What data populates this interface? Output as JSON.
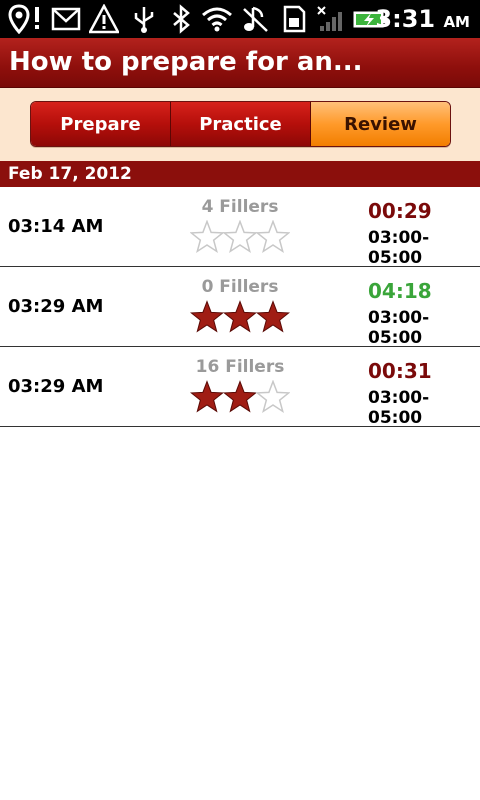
{
  "status_bar": {
    "time": "3:31",
    "ampm": "AM",
    "icons": [
      "location-alert-icon",
      "gmail-icon",
      "warning-icon",
      "usb-icon",
      "bluetooth-icon",
      "wifi-icon",
      "music-off-icon",
      "sd-card-icon",
      "no-signal-icon",
      "battery-charging-icon"
    ]
  },
  "header": {
    "title": "How to prepare for an..."
  },
  "tabs": [
    {
      "label": "Prepare",
      "active": false
    },
    {
      "label": "Practice",
      "active": false
    },
    {
      "label": "Review",
      "active": true
    }
  ],
  "section": {
    "date": "Feb 17, 2012"
  },
  "sessions": [
    {
      "time": "03:14 AM",
      "fillers": "4 Fillers",
      "stars": 0,
      "max_stars": 3,
      "duration": "00:29",
      "duration_color": "#7a0a0a",
      "window": "03:00-05:00"
    },
    {
      "time": "03:29 AM",
      "fillers": "0 Fillers",
      "stars": 3,
      "max_stars": 3,
      "duration": "04:18",
      "duration_color": "#3aa53a",
      "window": "03:00-05:00"
    },
    {
      "time": "03:29 AM",
      "fillers": "16 Fillers",
      "stars": 2,
      "max_stars": 3,
      "duration": "00:31",
      "duration_color": "#7a0a0a",
      "window": "03:00-05:00"
    }
  ],
  "colors": {
    "star_filled": "#a01d14",
    "star_empty_stroke": "#c8c8c8"
  }
}
